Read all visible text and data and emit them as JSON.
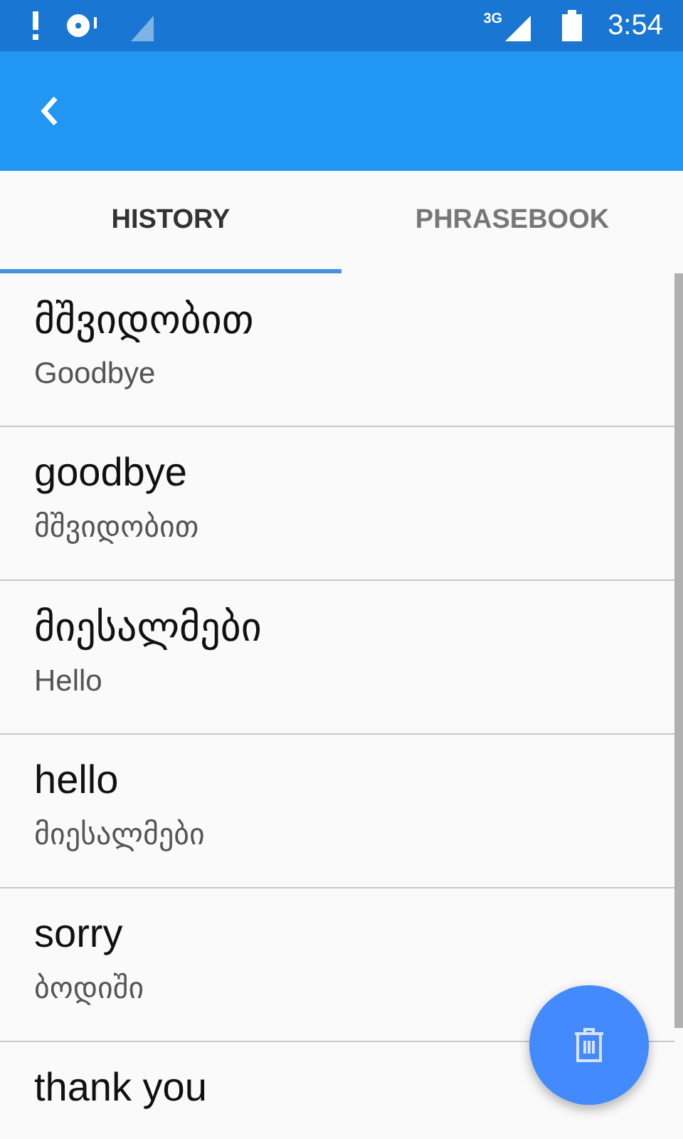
{
  "status_bar": {
    "time": "3:54",
    "network": "3G"
  },
  "tabs": [
    {
      "label": "HISTORY",
      "selected": true
    },
    {
      "label": "PHRASEBOOK",
      "selected": false
    }
  ],
  "history": [
    {
      "text": "მშვიდობით",
      "translation": "Goodbye"
    },
    {
      "text": "goodbye",
      "translation": "მშვიდობით"
    },
    {
      "text": "მიესალმები",
      "translation": "Hello"
    },
    {
      "text": "hello",
      "translation": "მიესალმები"
    },
    {
      "text": "sorry",
      "translation": "ბოდიში"
    },
    {
      "text": "thank you"
    }
  ]
}
